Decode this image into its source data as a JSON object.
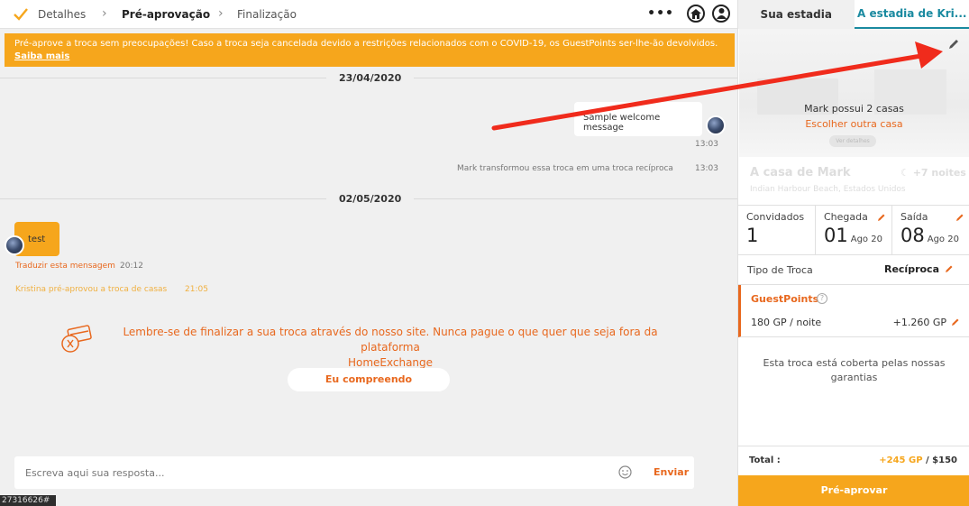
{
  "steps": [
    {
      "label": "Detalhes",
      "state": "done"
    },
    {
      "label": "Pré-aprovação",
      "state": "active"
    },
    {
      "label": "Finalização",
      "state": "pending"
    }
  ],
  "topbar": {
    "more_icon": "more-dots-icon",
    "home_icon": "home-icon",
    "user_icon": "user-icon"
  },
  "banner": {
    "text": "Pré-aprove a troca sem preocupações! Caso a troca seja cancelada devido a restrições relacionados com o COVID-19, os GuestPoints ser-lhe-ão devolvidos.",
    "link": "Saiba mais"
  },
  "chat": {
    "date1": "23/04/2020",
    "msg1": {
      "text": "Sample welcome message",
      "time": "13:03"
    },
    "event1": {
      "text": "Mark transformou essa troca em uma troca recíproca",
      "time": "13:03"
    },
    "date2": "02/05/2020",
    "msg2": {
      "text": "test",
      "translate": "Traduzir esta mensagem",
      "time": "20:12"
    },
    "event2": {
      "text": "Kristina pré-aprovou a troca de casas",
      "time": "21:05"
    },
    "reminder_line1": "Lembre-se de finalizar a sua troca através do nosso site. Nunca pague o que quer que seja fora da plataforma",
    "reminder_line2": "HomeExchange",
    "understand_button": "Eu compreendo"
  },
  "composer": {
    "placeholder": "Escreva aqui sua resposta...",
    "send": "Enviar"
  },
  "session_tag": "27316626#",
  "tabs": {
    "yours": "Sua estadia",
    "theirs": "A estadia de Kri..."
  },
  "house": {
    "owner_text": "Mark possui 2 casas",
    "choose_other": "Escolher outra casa",
    "view_pill": "Ver detalhes",
    "name": "A casa de Mark",
    "location": "Indian Harbour Beach, Estados Unidos",
    "nights": "+7 noites"
  },
  "details": {
    "guests_label": "Convidados",
    "guests_value": "1",
    "arrival_label": "Chegada",
    "arrival_day": "01",
    "arrival_month": "Ago 20",
    "departure_label": "Saída",
    "departure_day": "08",
    "departure_month": "Ago 20"
  },
  "trade": {
    "label": "Tipo de Troca",
    "value": "Recíproca"
  },
  "guestpoints": {
    "title": "GuestPoints",
    "rate": "180 GP / noite",
    "amount": "+1.260 GP"
  },
  "coverage": "Esta troca está coberta pelas nossas garantias",
  "total": {
    "label": "Total :",
    "gp": "+245 GP",
    "sep": " / ",
    "money": "$150"
  },
  "preapprove_button": "Pré-aprovar",
  "colors": {
    "accent": "#f6a61c",
    "link": "#e8681e",
    "teal": "#1a8aa0",
    "annotation_arrow": "#f02b1c"
  }
}
